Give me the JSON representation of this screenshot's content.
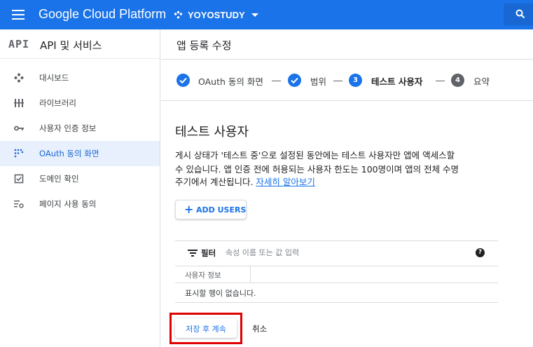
{
  "topbar": {
    "brand": "Google Cloud Platform",
    "project": "YOYOSTUDY",
    "search_icon": "search-icon"
  },
  "sidebar": {
    "logo": "API",
    "title": "API 및 서비스",
    "items": [
      {
        "label": "대시보드",
        "icon": "dashboard-icon",
        "active": false
      },
      {
        "label": "라이브러리",
        "icon": "library-icon",
        "active": false
      },
      {
        "label": "사용자 인증 정보",
        "icon": "key-icon",
        "active": false
      },
      {
        "label": "OAuth 동의 화면",
        "icon": "consent-icon",
        "active": true
      },
      {
        "label": "도메인 확인",
        "icon": "checkbox-icon",
        "active": false
      },
      {
        "label": "페이지 사용 동의",
        "icon": "settings-list-icon",
        "active": false
      }
    ]
  },
  "main": {
    "page_title": "앱 등록 수정",
    "steps": [
      {
        "label": "OAuth 동의 화면",
        "status": "done"
      },
      {
        "label": "범위",
        "status": "done"
      },
      {
        "label": "테스트 사용자",
        "number": "3",
        "status": "current"
      },
      {
        "label": "요약",
        "number": "4",
        "status": "todo"
      }
    ],
    "section_title": "테스트 사용자",
    "description": {
      "line1": "게시 상태가 '테스트 중'으로 설정된 동안에는 테스트 사용자만 앱에 액세스할",
      "line2": "수 있습니다. 앱 인증 전에 허용되는 사용자 한도는 100명이며 앱의 전체 수명",
      "line3": "주기에서 계산됩니다. ",
      "link": "자세히 알아보기"
    },
    "add_users": "ADD USERS",
    "table": {
      "filter_label": "필터",
      "filter_placeholder": "속성 이름 또는 값 입력",
      "help": "?",
      "column_header": "사용자 정보",
      "empty_message": "표시할 행이 없습니다."
    },
    "actions": {
      "save": "저장 후 계속",
      "cancel": "취소"
    }
  },
  "colors": {
    "primary": "#1a73e8",
    "active_bg": "#e8f0fe",
    "highlight": "#e00000"
  }
}
